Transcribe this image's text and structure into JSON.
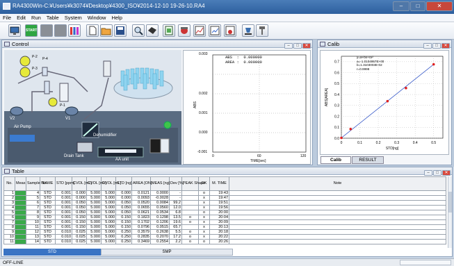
{
  "window": {
    "title": "RA4300Win-C:¥Users¥k3074¥Desktop¥4300_ISO¥2014-12-10 19-26-10.RA4"
  },
  "menu": [
    "File",
    "Edit",
    "Run",
    "Table",
    "System",
    "Window",
    "Help"
  ],
  "toolbar": {
    "start_label": "START"
  },
  "control": {
    "title": "Control",
    "labels": {
      "v2": "V2",
      "v1": "V1",
      "p1": "P-1",
      "p2": "P-2",
      "p3": "P-3",
      "p4": "P-4",
      "air_pump": "Air Pump",
      "dehumidifier": "Dehumidifier",
      "drain_tank": "Drain Tank",
      "aa_unit": "AA unit"
    },
    "plot": {
      "readout_abs": "ABS  :  0.000000",
      "readout_area": "AREA :  0.000000",
      "y_label": "ABS",
      "x_label": "TIME[sec]",
      "y_ticks": [
        "0.003",
        "0.002",
        "0.001",
        "0.000",
        "-0.001"
      ],
      "x_ticks": [
        "0",
        "60",
        "120"
      ]
    }
  },
  "calib": {
    "title": "Calib",
    "eq": [
      "y=a+bx+cx²",
      "a=-1.0104957E+00",
      "b=1.3103003E-02",
      "r=0.9998"
    ],
    "tabs": [
      "Calib",
      "RESULT"
    ],
    "chart_data": {
      "type": "line",
      "xlabel": "STD[ng]",
      "ylabel": "ABS[AREA]",
      "x_ticks": [
        "0",
        "0.1",
        "0.2",
        "0.3",
        "0.4",
        "0.5"
      ],
      "y_ticks": [
        "0.7",
        "0.6",
        "0.5",
        "0.4",
        "0.3",
        "0.2",
        "0.1",
        "0.0"
      ],
      "xlim": [
        0,
        0.55
      ],
      "ylim": [
        0,
        0.75
      ],
      "points": [
        {
          "x": 0.0,
          "y": 0.003
        },
        {
          "x": 0.05,
          "y": 0.084
        },
        {
          "x": 0.25,
          "y": 0.339
        },
        {
          "x": 0.35,
          "y": 0.459
        },
        {
          "x": 0.5,
          "y": 0.676
        }
      ],
      "fit": [
        [
          0,
          0.003
        ],
        [
          0.5,
          0.676
        ]
      ]
    }
  },
  "table": {
    "title": "Table",
    "columns": [
      "No.",
      "Meas",
      "Sample No.",
      "NAME",
      "STD [ppm]",
      "CVOL [mL]",
      "CVOL [mL]",
      "DVOL [mL]",
      "STD [ng]",
      "AREA [ON]",
      "MEAS [ng]",
      "Dev [%]",
      "PEAK Shape",
      "OK",
      "M. TIME",
      "Note"
    ],
    "rows": [
      [
        "1",
        "",
        "4",
        "STD",
        "0.001",
        "0.000",
        "5.000",
        "5.000",
        "0.000",
        "0.0121",
        "0.0000",
        "-",
        "",
        "o",
        "19:43",
        ""
      ],
      [
        "2",
        "",
        "5",
        "STD",
        "0.001",
        "0.000",
        "5.000",
        "5.000",
        "0.000",
        "0.0093",
        "-0.0028",
        "-",
        "",
        "x",
        "19:47",
        ""
      ],
      [
        "3",
        "",
        "6",
        "STD",
        "0.001",
        "0.050",
        "5.000",
        "5.000",
        "0.050",
        "0.0520",
        "0.0084",
        "99.2",
        "",
        "x",
        "19:51",
        ""
      ],
      [
        "4",
        "",
        "7",
        "STD",
        "0.001",
        "0.050",
        "5.000",
        "5.000",
        "0.050",
        "0.0655",
        "0.0560",
        "12.0",
        "",
        "x",
        "19:56",
        ""
      ],
      [
        "5",
        "",
        "8",
        "STD",
        "0.001",
        "0.050",
        "5.000",
        "5.000",
        "0.050",
        "0.0621",
        "0.0534",
        "6.8",
        "",
        "o",
        "20:00",
        ""
      ],
      [
        "6",
        "",
        "9",
        "STD",
        "0.001",
        "0.150",
        "5.000",
        "5.000",
        "0.150",
        "0.1823",
        "0.1298",
        "13.5",
        "o",
        "x",
        "20:04",
        ""
      ],
      [
        "7",
        "",
        "10",
        "STD",
        "0.001",
        "0.150",
        "5.000",
        "5.000",
        "0.150",
        "0.1702",
        "0.1206",
        "19.6",
        "o",
        "x",
        "20:09",
        ""
      ],
      [
        "8",
        "",
        "11",
        "STD",
        "0.001",
        "0.150",
        "5.000",
        "5.000",
        "0.150",
        "0.0796",
        "0.0515",
        "65.7",
        "",
        "x",
        "20:13",
        ""
      ],
      [
        "9",
        "",
        "12",
        "STD",
        "0.010",
        "0.025",
        "5.000",
        "5.000",
        "0.250",
        "0.3579",
        "0.2638",
        "5.5",
        "o",
        "x",
        "20:18",
        ""
      ],
      [
        "10",
        "",
        "13",
        "STD",
        "0.010",
        "0.025",
        "5.000",
        "5.000",
        "0.250",
        "0.2835",
        "0.2070",
        "17.2",
        "o",
        "x",
        "20:22",
        ""
      ],
      [
        "11",
        "",
        "14",
        "STD",
        "0.010",
        "0.025",
        "5.000",
        "5.000",
        "0.250",
        "0.3469",
        "0.2554",
        "2.2",
        "o",
        "o",
        "20:26",
        ""
      ]
    ],
    "bottom_tabs": [
      "STD",
      "SMP"
    ]
  },
  "status": {
    "text": "OFF-LINE"
  }
}
